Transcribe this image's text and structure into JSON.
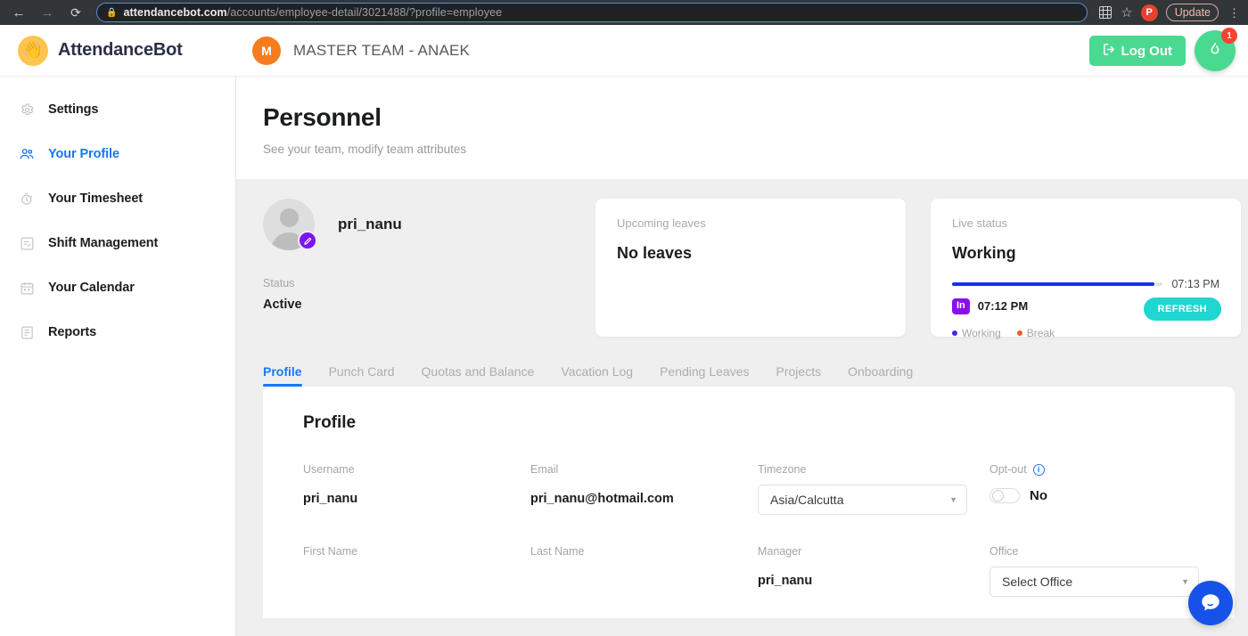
{
  "browser": {
    "back_icon": "arrow-left-icon",
    "forward_icon": "arrow-right-icon",
    "reload_icon": "reload-icon",
    "lock_icon": "lock-icon",
    "url_domain": "attendancebot.com",
    "url_path": "/accounts/employee-detail/3021488/?profile=employee",
    "extension_icon": "extension-icon",
    "bookmark_icon": "star-icon",
    "profile_initial": "P",
    "update_label": "Update",
    "menu_icon": "kebab-menu-icon"
  },
  "header": {
    "brand": "AttendanceBot",
    "brand_icon": "waving-hand-icon",
    "team_initial": "M",
    "team_name": "MASTER TEAM - ANAEK",
    "logout_label": "Log Out",
    "logout_icon": "logout-icon",
    "fab_icon": "flame-icon",
    "fab_badge": "1"
  },
  "sidebar": {
    "items": [
      {
        "label": "Settings",
        "icon": "gear-icon",
        "active": false
      },
      {
        "label": "Your Profile",
        "icon": "people-icon",
        "active": true
      },
      {
        "label": "Your Timesheet",
        "icon": "stopwatch-icon",
        "active": false
      },
      {
        "label": "Shift Management",
        "icon": "shift-document-icon",
        "active": false
      },
      {
        "label": "Your Calendar",
        "icon": "calendar-icon",
        "active": false
      },
      {
        "label": "Reports",
        "icon": "report-icon",
        "active": false
      }
    ]
  },
  "page": {
    "title": "Personnel",
    "subtitle": "See your team, modify team attributes"
  },
  "person": {
    "avatar_icon": "user-avatar-icon",
    "edit_icon": "pencil-icon",
    "name": "pri_nanu",
    "status_label": "Status",
    "status_value": "Active"
  },
  "leaves_card": {
    "label": "Upcoming leaves",
    "value": "No leaves"
  },
  "live_card": {
    "label": "Live status",
    "value": "Working",
    "bar_end_time": "07:13 PM",
    "bar_percent": 96,
    "punch_badge": "In",
    "punch_time": "07:12 PM",
    "legend": [
      {
        "label": "Working",
        "color": "#3b2ce0"
      },
      {
        "label": "Break",
        "color": "#f45b2a"
      }
    ],
    "refresh_label": "REFRESH",
    "refresh_color": "#1fd6d0"
  },
  "tabs": [
    {
      "label": "Profile",
      "active": true
    },
    {
      "label": "Punch Card",
      "active": false
    },
    {
      "label": "Quotas and Balance",
      "active": false
    },
    {
      "label": "Vacation Log",
      "active": false
    },
    {
      "label": "Pending Leaves",
      "active": false
    },
    {
      "label": "Projects",
      "active": false
    },
    {
      "label": "Onboarding",
      "active": false
    }
  ],
  "profile_panel": {
    "title": "Profile",
    "username_label": "Username",
    "username_value": "pri_nanu",
    "email_label": "Email",
    "email_value": "pri_nanu@hotmail.com",
    "timezone_label": "Timezone",
    "timezone_value": "Asia/Calcutta",
    "optout_label": "Opt-out",
    "optout_info_icon": "info-icon",
    "optout_value": "No",
    "first_name_label": "First Name",
    "first_name_value": "",
    "last_name_label": "Last Name",
    "last_name_value": "",
    "manager_label": "Manager",
    "manager_value": "pri_nanu",
    "office_label": "Office",
    "office_value": "Select Office"
  },
  "chat": {
    "icon": "chat-bubble-icon"
  },
  "colors": {
    "accent_blue": "#1677ff",
    "brand_green": "#4ad991",
    "teal": "#1fd6d0",
    "purple": "#8b0ef0",
    "bar_blue": "#1a2ef0",
    "background": "#efefef"
  }
}
